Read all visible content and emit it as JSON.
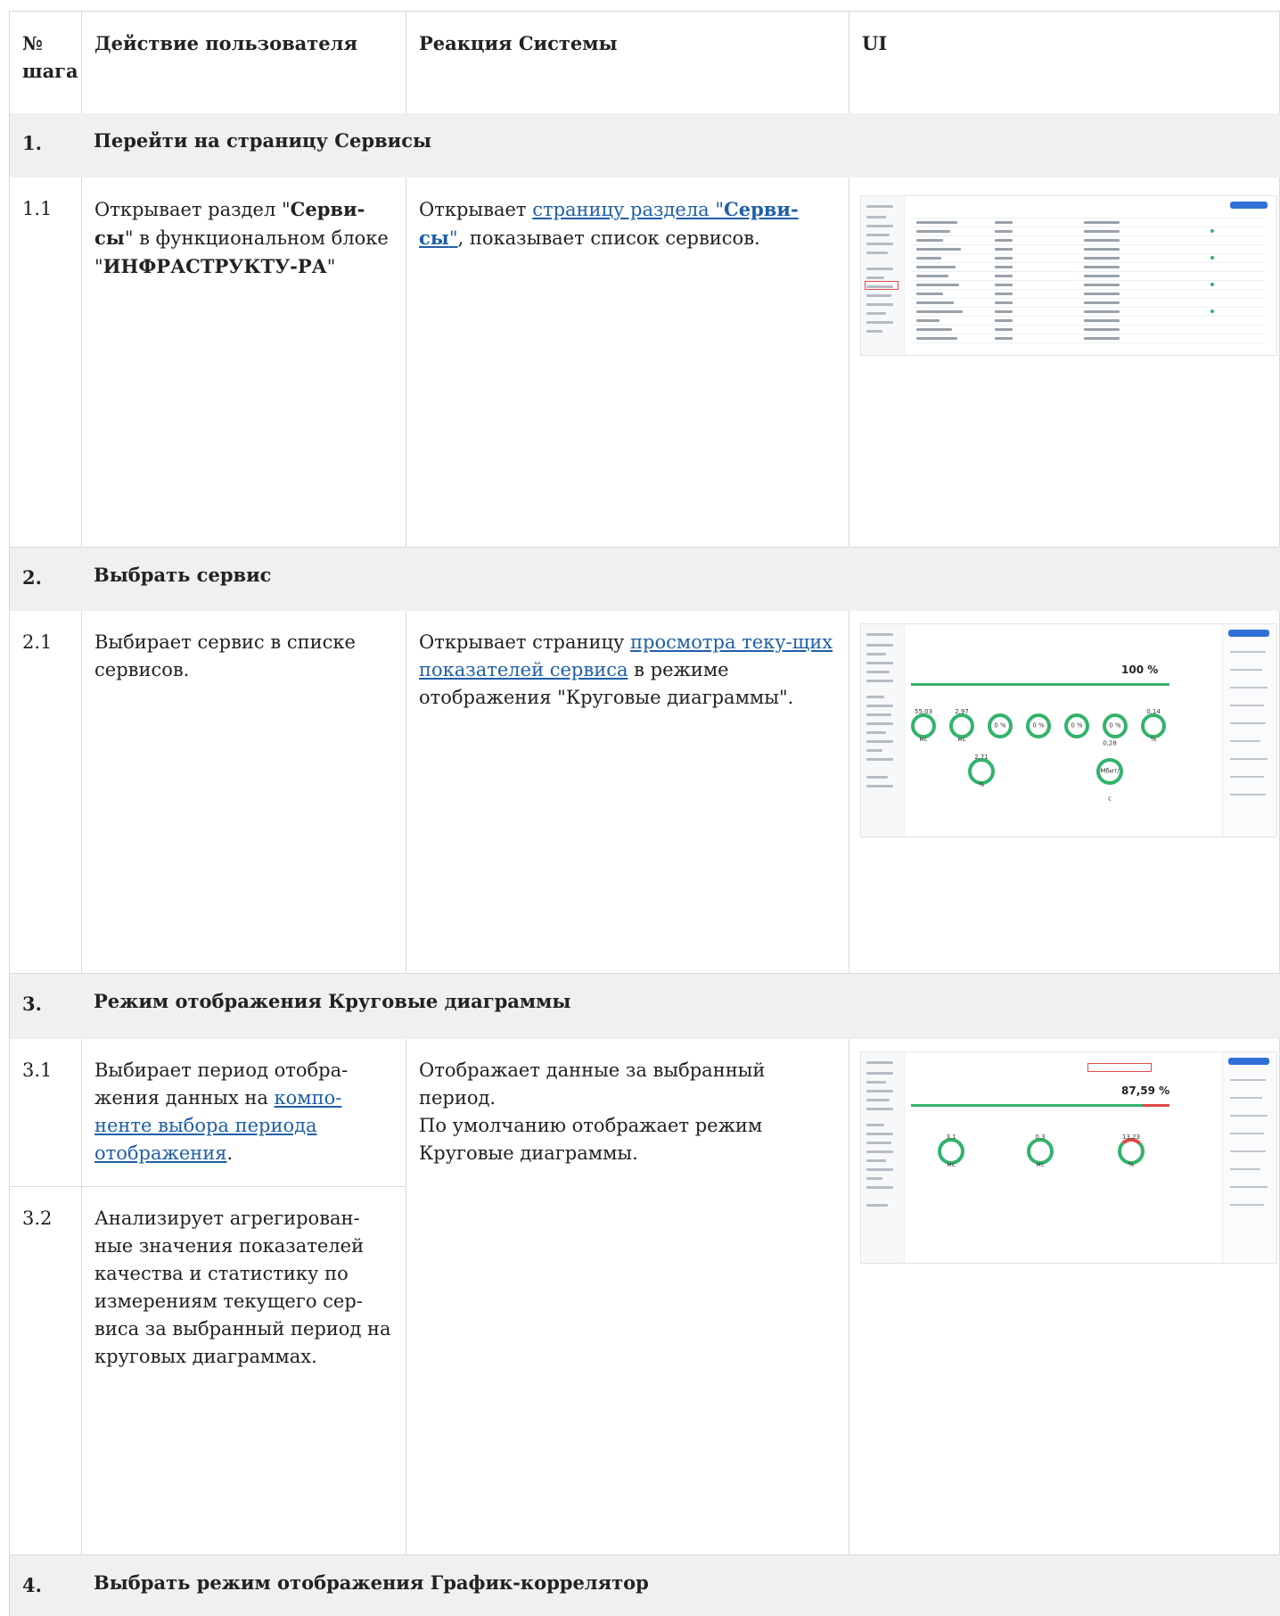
{
  "header": {
    "col_num": "№ шага",
    "col_user": "Действие пользователя",
    "col_system": "Реакция Системы",
    "col_ui": "UI"
  },
  "sections": [
    {
      "num": "1.",
      "title": "Перейти на страницу Сервисы"
    },
    {
      "num": "2.",
      "title": "Выбрать сервис"
    },
    {
      "num": "3.",
      "title": "Режим отображения Круговые диаграммы"
    },
    {
      "num": "4.",
      "title": "Выбрать режим отображения График-коррелятор"
    }
  ],
  "steps": {
    "s11": {
      "num": "1.1",
      "user_a": "Открывает раздел \"",
      "user_b": "Серви-сы",
      "user_c": "\" в функциональном блоке \"",
      "user_d": "ИНФРАСТРУКТУ-РА",
      "user_e": "\"",
      "sys_a": "Открывает ",
      "sys_link_a": "страницу раздела \"",
      "sys_link_b": "Серви-сы",
      "sys_link_c": "\"",
      "sys_b": ", показывает список сервисов."
    },
    "s21": {
      "num": "2.1",
      "user": "Выбирает сервис в списке сервисов.",
      "sys_a": "Открывает страницу ",
      "sys_link": "просмотра теку-щих показателей сервиса",
      "sys_b": " в режиме отображения \"Круговые диаграммы\"."
    },
    "s31": {
      "num": "3.1",
      "user_a": "Выбирает период отобра-жения данных на ",
      "user_link": "компо-ненте выбора периода отображения",
      "user_b": ".",
      "sys": "Отображает данные за выбранный период.\nПо умолчанию отображает режим Круговые диаграммы."
    },
    "s32": {
      "num": "3.2",
      "user": "Анализирует агрегирован-ные значения показателей качества и статистику по измерениям текущего сер-виса за выбранный период на круговых диаграммах."
    }
  },
  "screenshots": {
    "shot2_rings": [
      "55,03 мс",
      "2,97 мс",
      "0 %",
      "0 %",
      "0 %",
      "0 %",
      "0,14 %"
    ],
    "shot2_stats": [
      "2,71 %",
      "0,28 Мбит/с"
    ],
    "shot2_pct": "100 %",
    "shot3_rings": [
      "3,1 мс",
      "0,3 мс",
      "13,23 %"
    ],
    "shot3_pct": "87,59 %"
  },
  "colors": {
    "link": "#1f5fa6",
    "section_bg": "#eef0f1",
    "ring_green": "#33b36b",
    "ring_red": "#e04848",
    "accent": "#2f6fd6"
  }
}
